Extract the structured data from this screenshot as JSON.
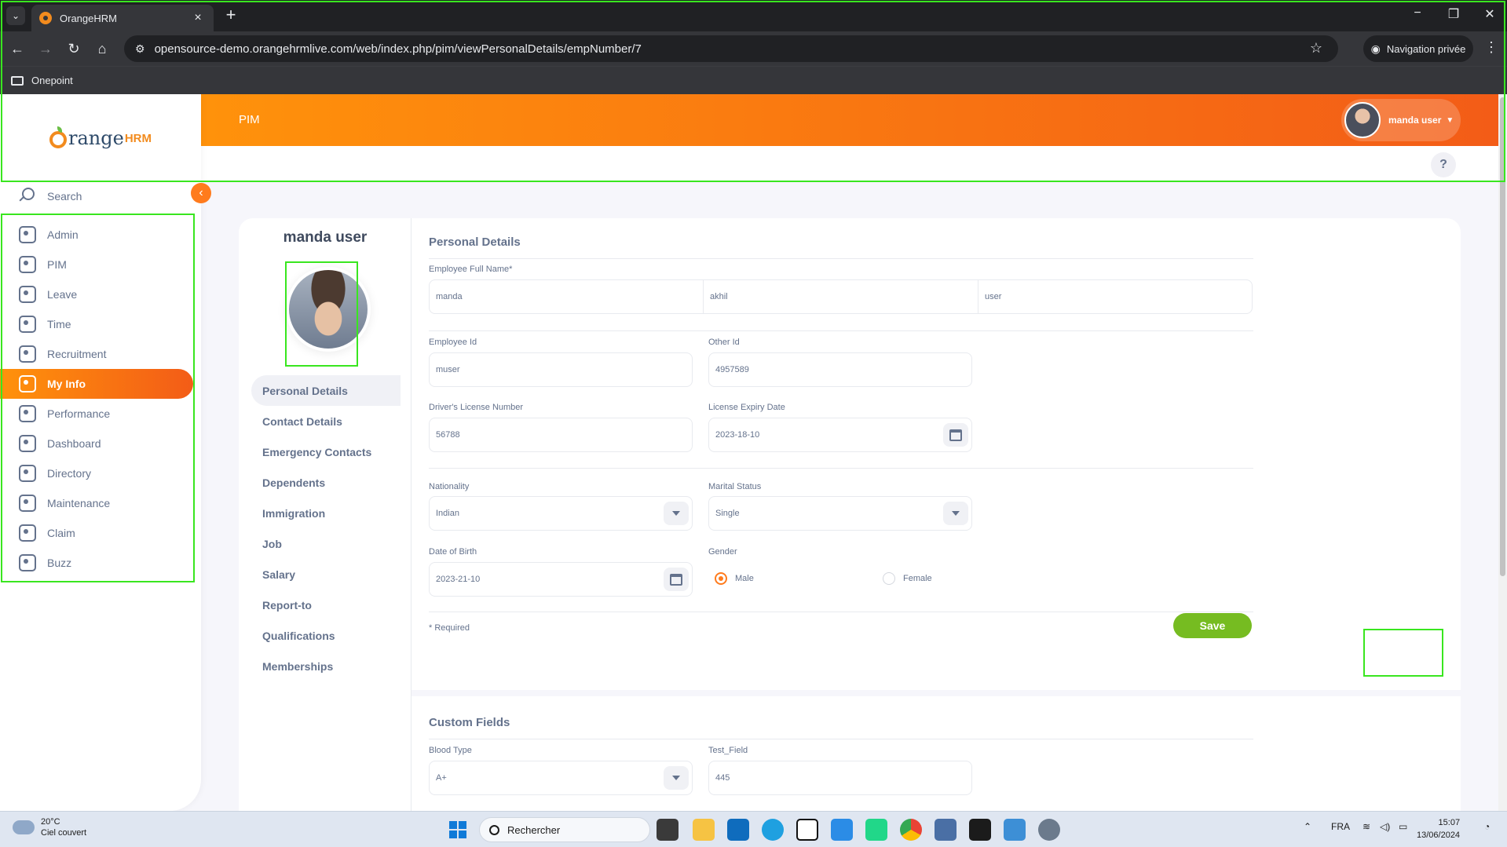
{
  "browser": {
    "tab_title": "OrangeHRM",
    "url": "opensource-demo.orangehrmlive.com/web/index.php/pim/viewPersonalDetails/empNumber/7",
    "incognito_label": "Navigation privée",
    "bookmark_folder": "Onepoint"
  },
  "app": {
    "logo_text": "range",
    "logo_suffix": "HRM",
    "module_title": "PIM",
    "user_name": "manda user",
    "search_label": "Search",
    "help_label": "?"
  },
  "sidebar": {
    "items": [
      {
        "label": "Admin",
        "icon": "admin-icon"
      },
      {
        "label": "PIM",
        "icon": "pim-icon"
      },
      {
        "label": "Leave",
        "icon": "leave-icon"
      },
      {
        "label": "Time",
        "icon": "time-icon"
      },
      {
        "label": "Recruitment",
        "icon": "recruitment-icon"
      },
      {
        "label": "My Info",
        "icon": "my-info-icon",
        "active": true
      },
      {
        "label": "Performance",
        "icon": "performance-icon"
      },
      {
        "label": "Dashboard",
        "icon": "dashboard-icon"
      },
      {
        "label": "Directory",
        "icon": "directory-icon"
      },
      {
        "label": "Maintenance",
        "icon": "maintenance-icon"
      },
      {
        "label": "Claim",
        "icon": "claim-icon"
      },
      {
        "label": "Buzz",
        "icon": "buzz-icon"
      }
    ]
  },
  "profile": {
    "name": "manda user",
    "tabs": [
      "Personal Details",
      "Contact Details",
      "Emergency Contacts",
      "Dependents",
      "Immigration",
      "Job",
      "Salary",
      "Report-to",
      "Qualifications",
      "Memberships"
    ]
  },
  "personal": {
    "section_title": "Personal Details",
    "full_name_label": "Employee Full Name*",
    "first_name": "manda",
    "middle_name": "akhil",
    "last_name": "user",
    "employee_id_label": "Employee Id",
    "employee_id": "muser",
    "other_id_label": "Other Id",
    "other_id": "4957589",
    "license_label": "Driver's License Number",
    "license": "56788",
    "expiry_label": "License Expiry Date",
    "expiry": "2023-18-10",
    "nationality_label": "Nationality",
    "nationality": "Indian",
    "marital_label": "Marital Status",
    "marital": "Single",
    "dob_label": "Date of Birth",
    "dob": "2023-21-10",
    "gender_label": "Gender",
    "gender_male": "Male",
    "gender_female": "Female",
    "required_note": "* Required",
    "save_label": "Save"
  },
  "custom": {
    "section_title": "Custom Fields",
    "blood_label": "Blood Type",
    "blood": "A+",
    "test_label": "Test_Field",
    "test": "445"
  },
  "taskbar": {
    "temp": "20°C",
    "weather": "Ciel couvert",
    "search_label": "Rechercher",
    "lang": "FRA",
    "time": "15:07",
    "date": "13/06/2024"
  },
  "colors": {
    "accent": "#ff7b1d",
    "save": "#76bc21",
    "highlight": "#39e61f"
  }
}
